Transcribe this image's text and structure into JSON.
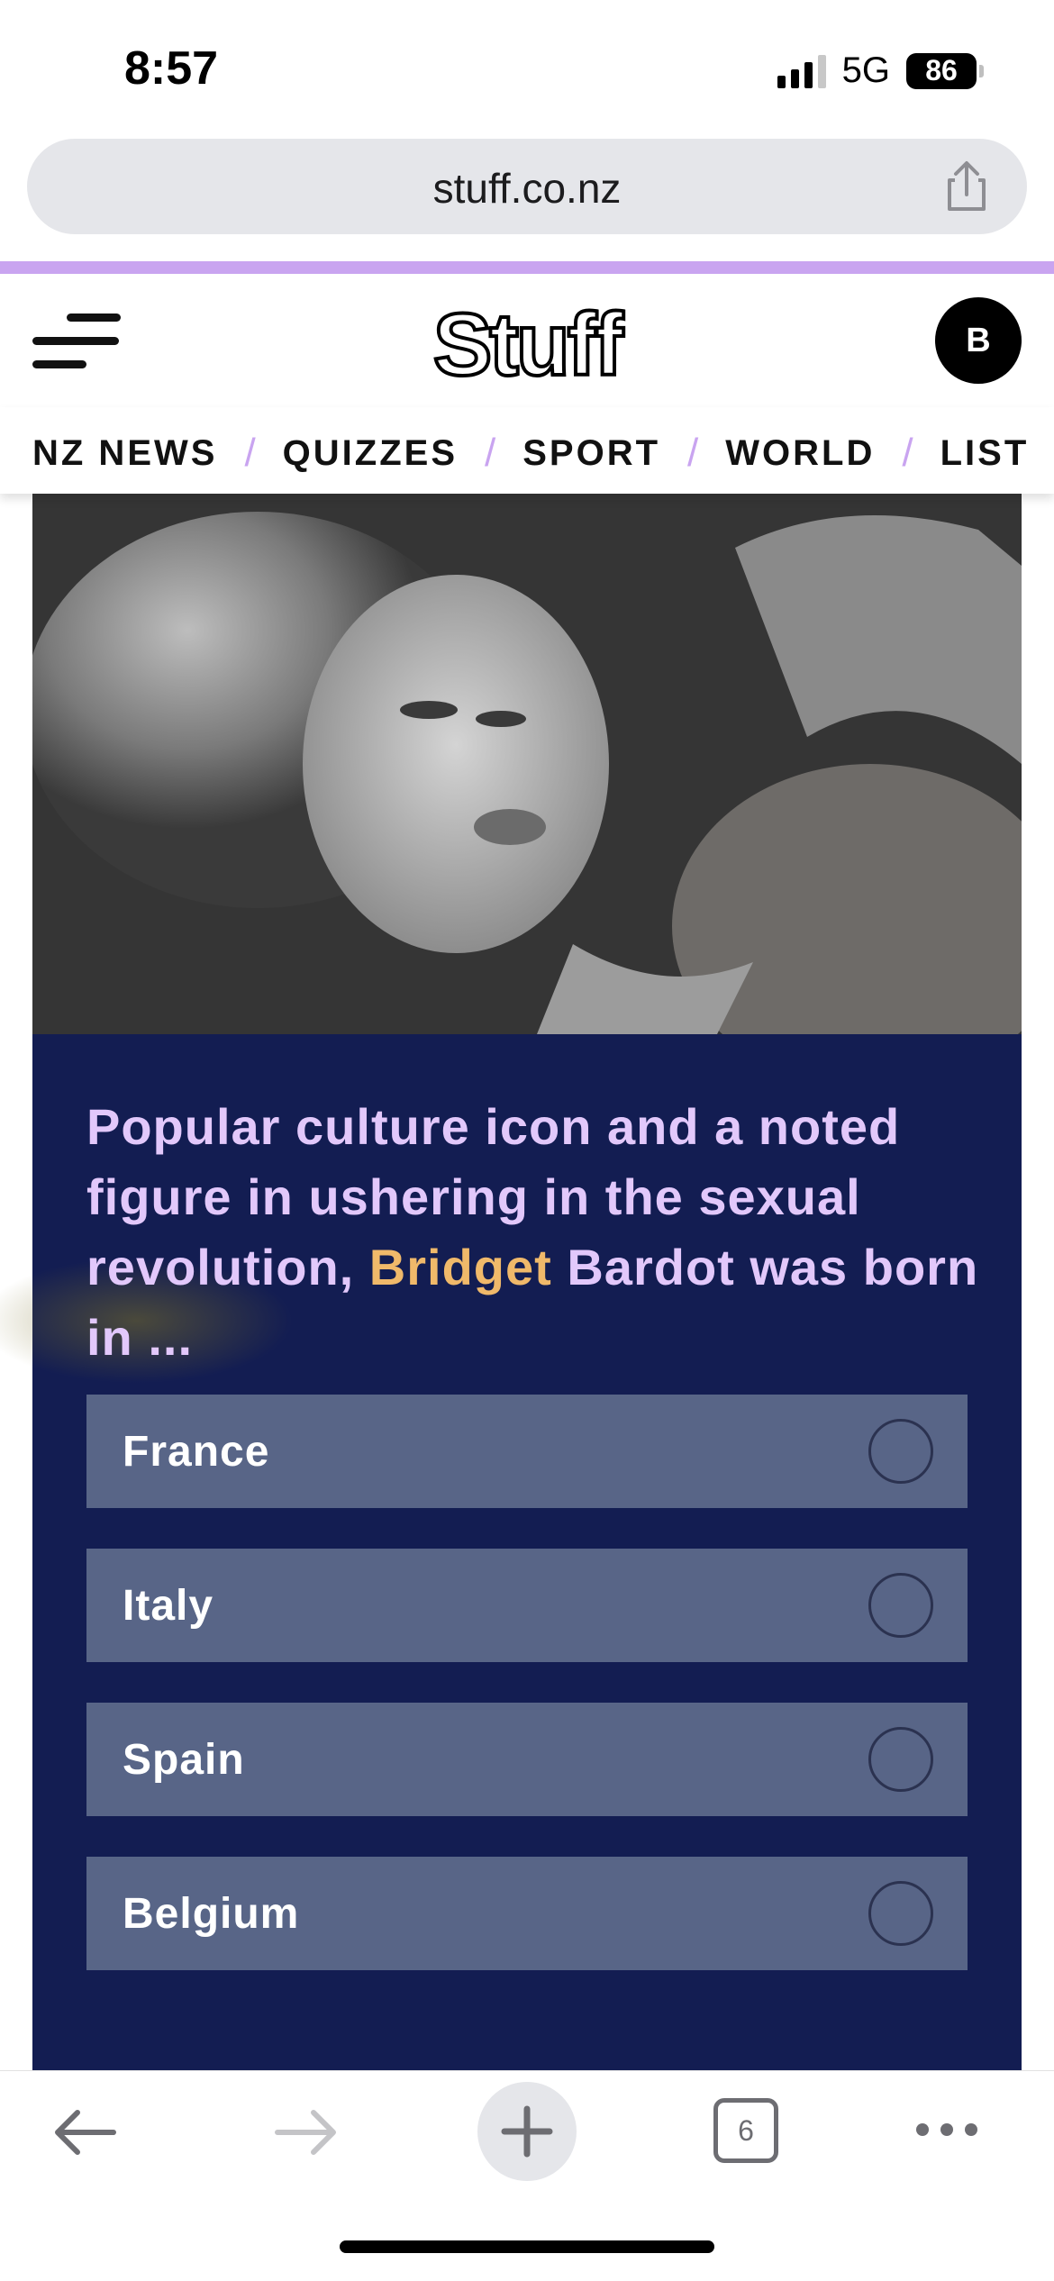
{
  "status_bar": {
    "time": "8:57",
    "network": "5G",
    "battery": "86",
    "signal_icon": "signal-bars-icon",
    "battery_icon": "battery-icon"
  },
  "browser": {
    "url": "stuff.co.nz",
    "share_icon": "share-icon",
    "toolbar": {
      "back_icon": "back-arrow-icon",
      "forward_icon": "forward-arrow-icon",
      "new_tab_icon": "plus-icon",
      "tab_count": "6",
      "more_icon": "more-dots-icon"
    }
  },
  "site": {
    "logo": "Stuff",
    "avatar_initial": "B",
    "menu_icon": "hamburger-menu-icon",
    "accent_color": "#c9a4f0"
  },
  "nav": {
    "items": [
      "NZ NEWS",
      "QUIZZES",
      "SPORT",
      "WORLD",
      "LIST"
    ],
    "separator": "/"
  },
  "quiz": {
    "question_before": "Popular culture icon and a noted figure in ushering in the sexual revolution, ",
    "question_highlight": "Bridget",
    "question_after": " Bardot was born in ...",
    "options": [
      {
        "label": "France"
      },
      {
        "label": "Italy"
      },
      {
        "label": "Spain"
      },
      {
        "label": "Belgium"
      }
    ],
    "panel_color": "#131d52",
    "option_color": "#586587",
    "question_color": "#e2c8fb",
    "highlight_color": "#f0b96a"
  }
}
